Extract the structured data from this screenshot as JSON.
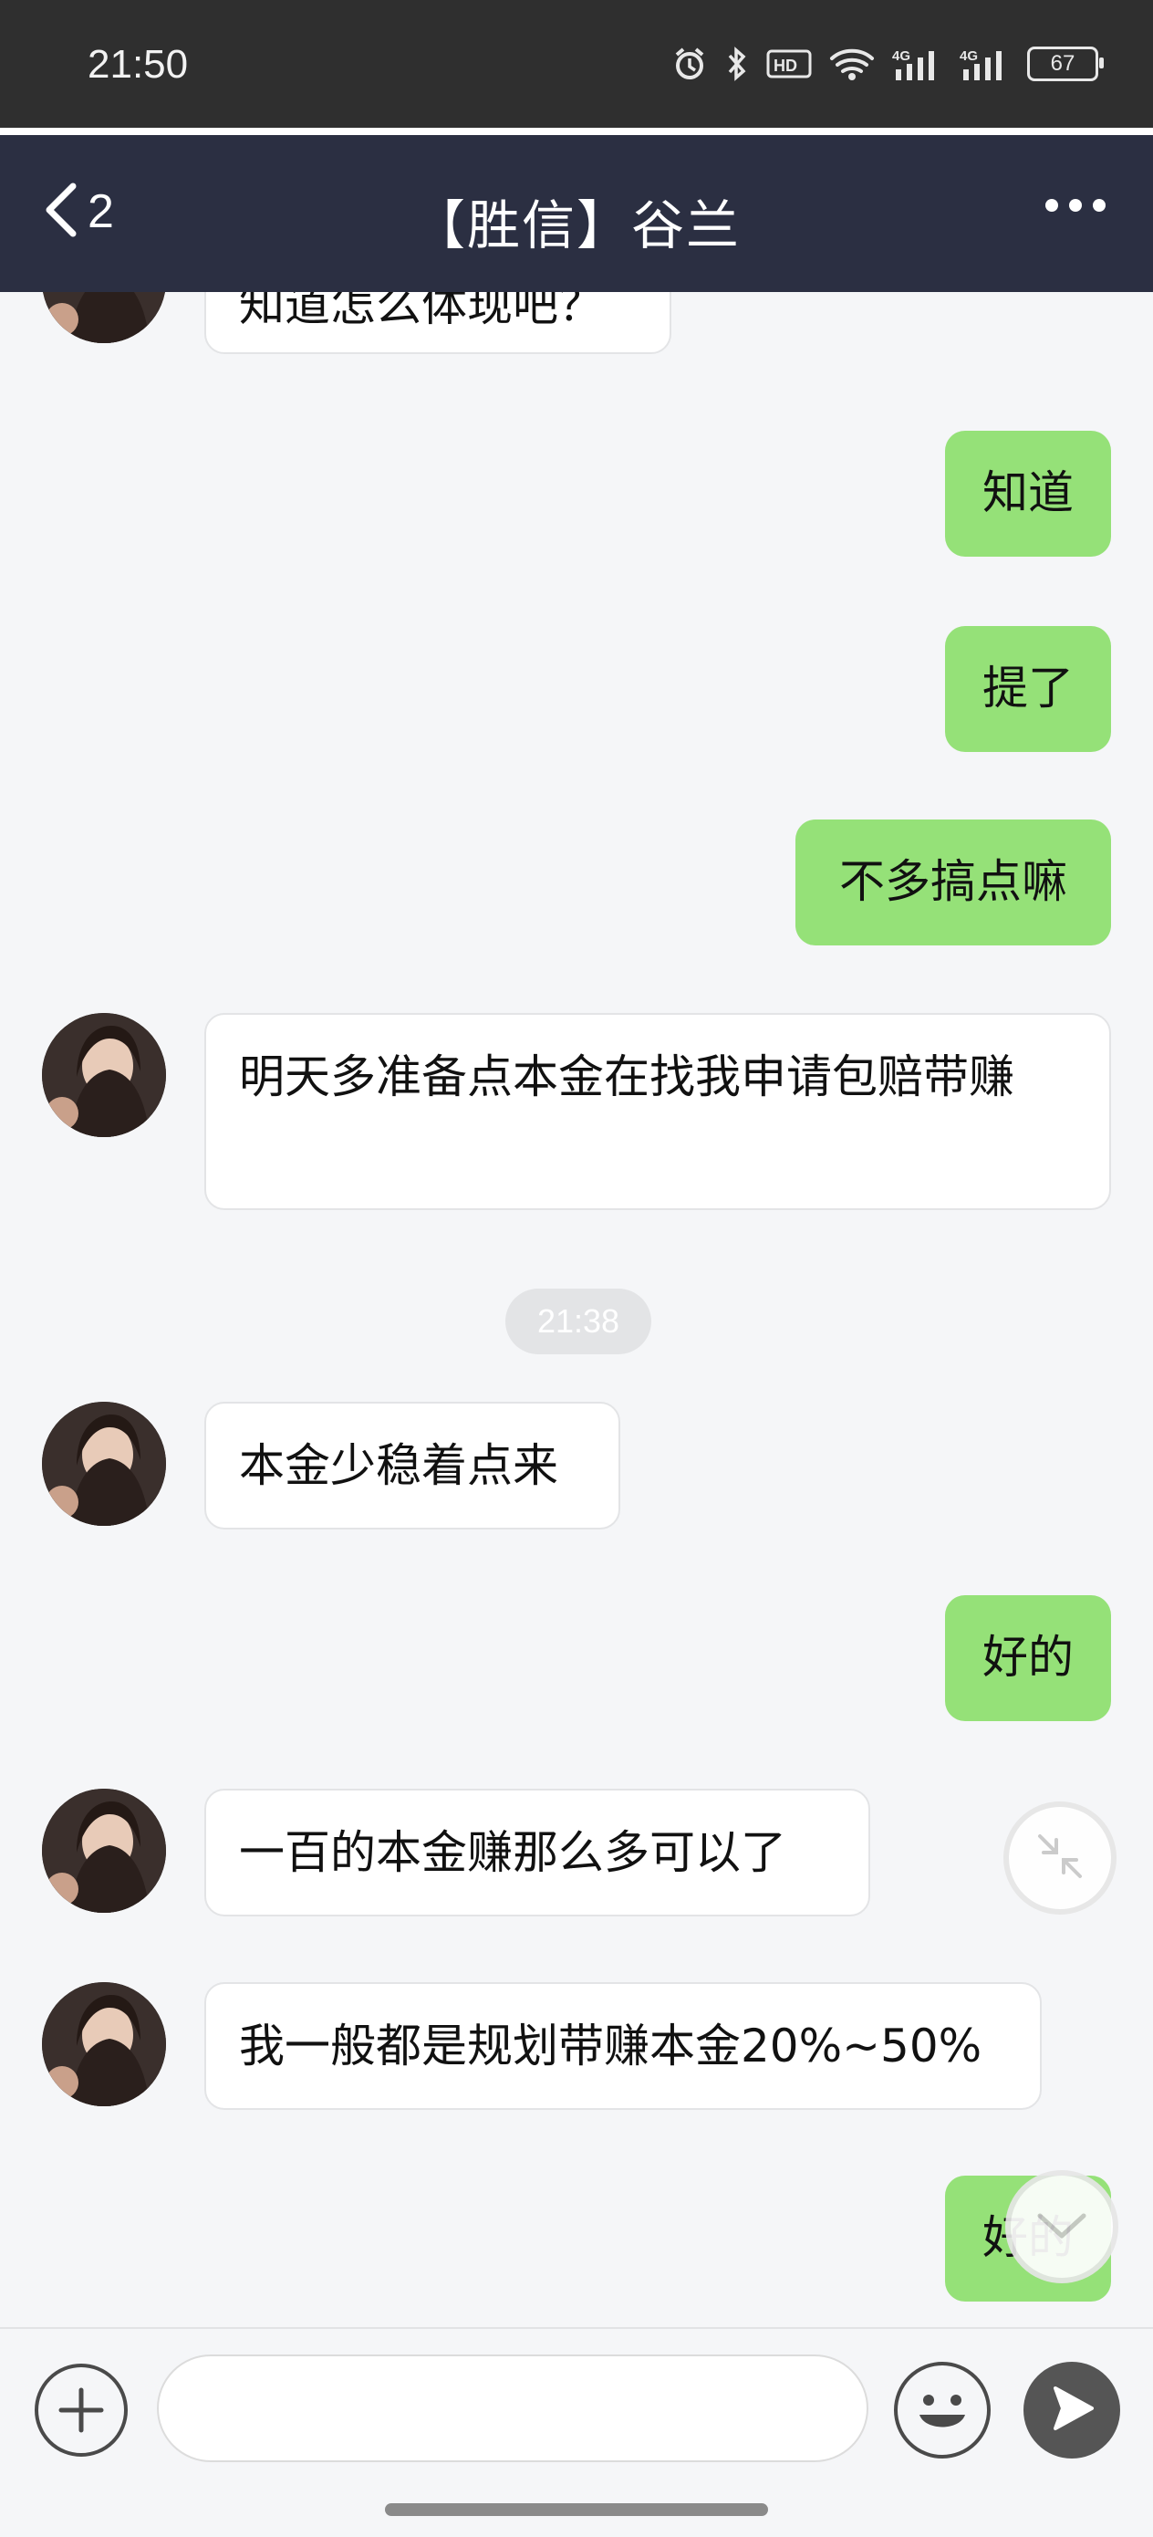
{
  "status_bar": {
    "time": "21:50",
    "network_1": "4G",
    "network_2": "4G",
    "hd_label": "HD",
    "battery": "67",
    "icons": [
      "alarm-icon",
      "bluetooth-icon",
      "hd-icon",
      "wifi-icon",
      "signal-icon",
      "signal-icon",
      "battery-icon"
    ]
  },
  "nav": {
    "back_count": "2",
    "title": "【胜信】谷兰",
    "more_icon": "more-dots-icon"
  },
  "messages": [
    {
      "side": "in",
      "text": "知道怎么体现吧？"
    },
    {
      "side": "out",
      "text": "知道"
    },
    {
      "side": "out",
      "text": "提了"
    },
    {
      "side": "out",
      "text": "不多搞点嘛"
    },
    {
      "side": "in",
      "text": "明天多准备点本金在找我申请包赔带赚"
    },
    {
      "side": "time",
      "text": "21:38"
    },
    {
      "side": "in",
      "text": "本金少稳着点来"
    },
    {
      "side": "out",
      "text": "好的"
    },
    {
      "side": "in",
      "text": "一百的本金赚那么多可以了"
    },
    {
      "side": "in",
      "text": "我一般都是规划带赚本金20%~50%"
    },
    {
      "side": "out",
      "text": "好的"
    }
  ],
  "input_bar": {
    "placeholder": "",
    "plus_icon": "plus-icon",
    "emoji_icon": "emoji-icon",
    "send_icon": "send-icon"
  },
  "colors": {
    "nav_bg": "#2b2f42",
    "outgoing_bubble": "#95e178",
    "incoming_bubble": "#ffffff",
    "chat_bg": "#f5f6f8"
  }
}
